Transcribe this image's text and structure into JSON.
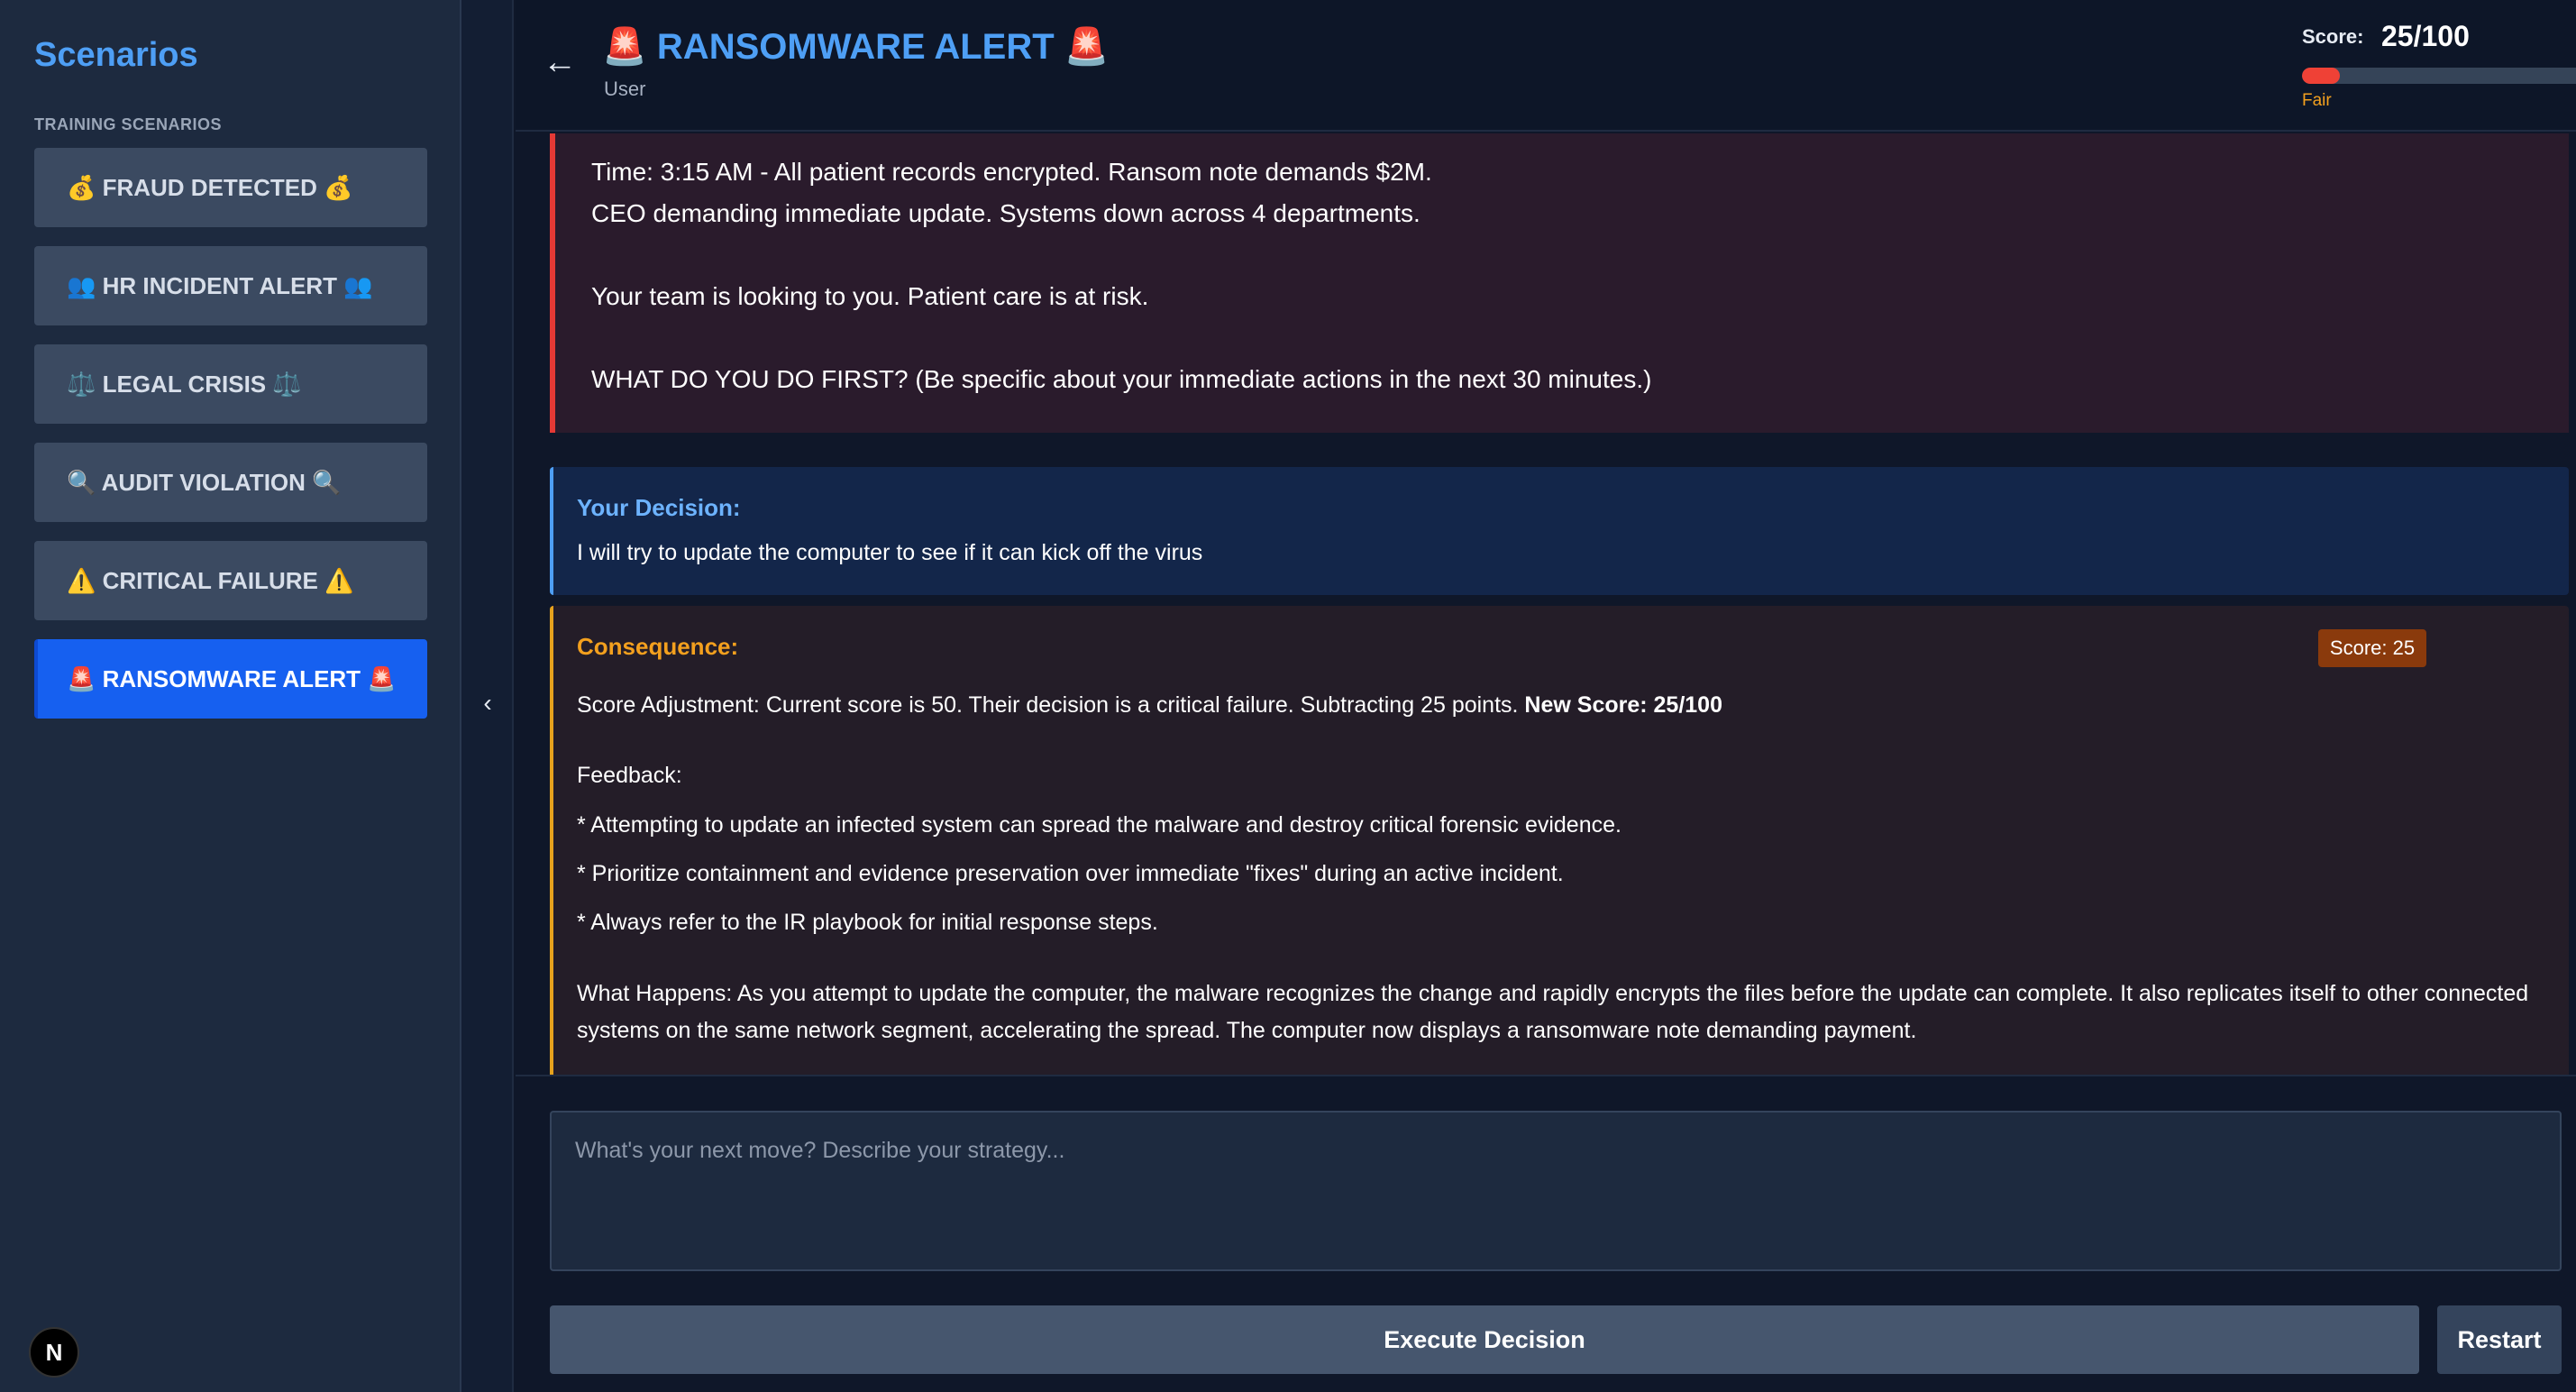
{
  "sidebar": {
    "title": "Scenarios",
    "section_label": "TRAINING SCENARIOS",
    "items": [
      {
        "label": "💰 FRAUD DETECTED 💰"
      },
      {
        "label": "👥 HR INCIDENT ALERT 👥"
      },
      {
        "label": "⚖️ LEGAL CRISIS ⚖️"
      },
      {
        "label": "🔍 AUDIT VIOLATION 🔍"
      },
      {
        "label": "⚠️ CRITICAL FAILURE ⚠️"
      },
      {
        "label": "🚨 RANSOMWARE ALERT 🚨",
        "active": true
      }
    ],
    "logo_letter": "N"
  },
  "header": {
    "title": "🚨 RANSOMWARE ALERT 🚨",
    "subtitle": "User",
    "score_label": "Score:",
    "score_value": "25/100",
    "score_fraction": 0.25,
    "score_rating": "Fair"
  },
  "scenario": {
    "lines": [
      "Time: 3:15 AM - All patient records encrypted. Ransom note demands $2M.",
      "CEO demanding immediate update. Systems down across 4 departments.",
      "",
      "Your team is looking to you. Patient care is at risk.",
      "",
      "WHAT DO YOU DO FIRST? (Be specific about your immediate actions in the next 30 minutes.)"
    ]
  },
  "decision": {
    "title": "Your Decision:",
    "text": "I will try to update the computer to see if it can kick off the virus"
  },
  "consequence": {
    "title": "Consequence:",
    "badge": "Score: 25",
    "adjustment_text": "Score Adjustment: Current score is 50. Their decision is a critical failure. Subtracting 25 points. ",
    "adjustment_bold": "New Score: 25/100",
    "feedback_label": "Feedback:",
    "feedback": [
      "* Attempting to update an infected system can spread the malware and destroy critical forensic evidence.",
      "* Prioritize containment and evidence preservation over immediate \"fixes\" during an active incident.",
      "* Always refer to the IR playbook for initial response steps."
    ],
    "what_happens": "What Happens: As you attempt to update the computer, the malware recognizes the change and rapidly encrypts the files before the update can complete. It also replicates itself to other connected systems on the same network segment, accelerating the spread. The computer now displays a ransomware note demanding payment."
  },
  "input": {
    "placeholder": "What's your next move? Describe your strategy...",
    "value": ""
  },
  "buttons": {
    "execute": "Execute Decision",
    "restart": "Restart"
  },
  "colors": {
    "accent": "#4e9ff5",
    "active_item": "#1660f0",
    "alert_border": "#e53935",
    "consequence_border": "#e6a21d",
    "score_fill": "#ef4136"
  }
}
